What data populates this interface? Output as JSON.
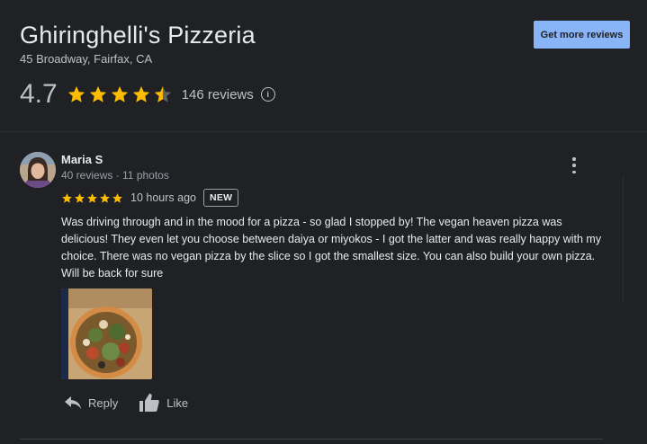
{
  "place": {
    "name": "Ghiringhelli's Pizzeria",
    "address": "45 Broadway, Fairfax, CA",
    "rating": "4.7",
    "rating_value": 4.7,
    "review_count": "146 reviews"
  },
  "cta": {
    "label": "Get more reviews"
  },
  "review": {
    "author": "Maria S",
    "meta": "40 reviews · 11 photos",
    "stars": 5,
    "time": "10 hours ago",
    "badge": "NEW",
    "text": "Was driving through and in the mood for a pizza - so glad I stopped by! The vegan heaven pizza was delicious! They even let you choose between daiya or miyokos - I got the latter and was really happy with my choice. There was no vegan pizza by the slice so I got the smallest size. You can also build your own pizza. Will be back for sure",
    "actions": {
      "reply": "Reply",
      "like": "Like"
    }
  },
  "colors": {
    "star": "#fbbc04",
    "accent": "#8ab4f8",
    "background": "#202124"
  },
  "icons": [
    "info-icon",
    "more-vert-icon",
    "reply-icon",
    "thumb-up-icon"
  ]
}
